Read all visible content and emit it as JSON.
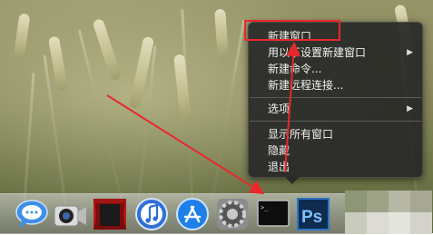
{
  "context_menu": {
    "items": [
      {
        "label": "新建窗口",
        "submenu": false
      },
      {
        "label": "用以下设置新建窗口",
        "submenu": true
      },
      {
        "label": "新建命令...",
        "submenu": false
      },
      {
        "label": "新建远程连接...",
        "submenu": false
      },
      {
        "label": "选项",
        "submenu": true
      },
      {
        "label": "显示所有窗口",
        "submenu": false
      },
      {
        "label": "隐藏",
        "submenu": false
      },
      {
        "label": "退出",
        "submenu": false
      }
    ],
    "submenu_arrow": "▶"
  },
  "dock": {
    "icons": [
      "messages-icon",
      "facetime-camera-icon",
      "photo-booth-icon",
      "itunes-icon",
      "app-store-icon",
      "system-preferences-icon",
      "terminal-icon",
      "photoshop-icon"
    ],
    "photoshop_label": "Ps",
    "terminal_prompt": ">_"
  },
  "annotation": {
    "highlight_color": "#e8282c",
    "arrow_color": "#e8282c"
  }
}
